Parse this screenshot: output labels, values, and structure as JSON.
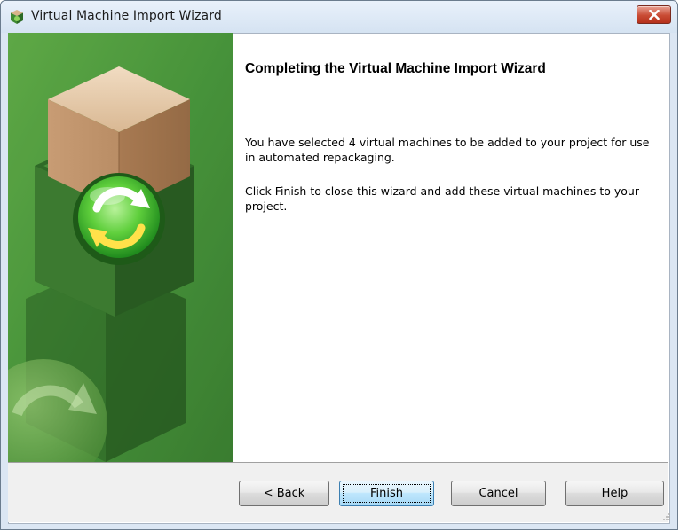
{
  "window": {
    "title": "Virtual Machine Import Wizard"
  },
  "content": {
    "heading": "Completing the Virtual Machine Import Wizard",
    "paragraph1": "You have selected 4 virtual machines to be added to your project for use in automated repackaging.",
    "paragraph2": "Click Finish to close this wizard and add these virtual machines to your project."
  },
  "buttons": {
    "back": "< Back",
    "finish": "Finish",
    "cancel": "Cancel",
    "help": "Help"
  },
  "colors": {
    "banner_green": "#3f8a33",
    "title_bar": "#dbe6f3",
    "close_button": "#c94b34"
  },
  "icons": {
    "app": "green-box-icon",
    "close": "close-icon",
    "banner": "box-refresh-illustration"
  }
}
